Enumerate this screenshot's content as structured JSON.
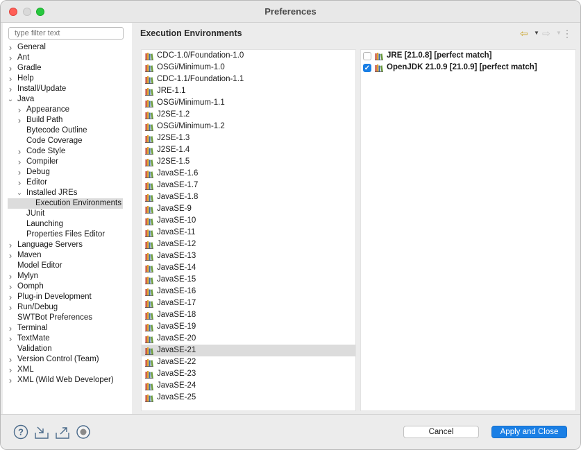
{
  "window": {
    "title": "Preferences"
  },
  "filter": {
    "placeholder": "type filter text"
  },
  "tree": [
    {
      "label": "General",
      "level": 0,
      "expandable": true,
      "expanded": false,
      "name": "tree-item-general"
    },
    {
      "label": "Ant",
      "level": 0,
      "expandable": true,
      "expanded": false,
      "name": "tree-item-ant"
    },
    {
      "label": "Gradle",
      "level": 0,
      "expandable": true,
      "expanded": false,
      "name": "tree-item-gradle"
    },
    {
      "label": "Help",
      "level": 0,
      "expandable": true,
      "expanded": false,
      "name": "tree-item-help"
    },
    {
      "label": "Install/Update",
      "level": 0,
      "expandable": true,
      "expanded": false,
      "name": "tree-item-install-update"
    },
    {
      "label": "Java",
      "level": 0,
      "expandable": true,
      "expanded": true,
      "name": "tree-item-java"
    },
    {
      "label": "Appearance",
      "level": 1,
      "expandable": true,
      "expanded": false,
      "name": "tree-item-appearance"
    },
    {
      "label": "Build Path",
      "level": 1,
      "expandable": true,
      "expanded": false,
      "name": "tree-item-build-path"
    },
    {
      "label": "Bytecode Outline",
      "level": 1,
      "expandable": false,
      "name": "tree-item-bytecode-outline"
    },
    {
      "label": "Code Coverage",
      "level": 1,
      "expandable": false,
      "name": "tree-item-code-coverage"
    },
    {
      "label": "Code Style",
      "level": 1,
      "expandable": true,
      "expanded": false,
      "name": "tree-item-code-style"
    },
    {
      "label": "Compiler",
      "level": 1,
      "expandable": true,
      "expanded": false,
      "name": "tree-item-compiler"
    },
    {
      "label": "Debug",
      "level": 1,
      "expandable": true,
      "expanded": false,
      "name": "tree-item-debug"
    },
    {
      "label": "Editor",
      "level": 1,
      "expandable": true,
      "expanded": false,
      "name": "tree-item-editor"
    },
    {
      "label": "Installed JREs",
      "level": 1,
      "expandable": true,
      "expanded": true,
      "name": "tree-item-installed-jres"
    },
    {
      "label": "Execution Environments",
      "level": 2,
      "expandable": false,
      "selected": true,
      "name": "tree-item-execution-environments"
    },
    {
      "label": "JUnit",
      "level": 1,
      "expandable": false,
      "name": "tree-item-junit"
    },
    {
      "label": "Launching",
      "level": 1,
      "expandable": false,
      "name": "tree-item-launching"
    },
    {
      "label": "Properties Files Editor",
      "level": 1,
      "expandable": false,
      "name": "tree-item-properties-files-editor"
    },
    {
      "label": "Language Servers",
      "level": 0,
      "expandable": true,
      "expanded": false,
      "name": "tree-item-language-servers"
    },
    {
      "label": "Maven",
      "level": 0,
      "expandable": true,
      "expanded": false,
      "name": "tree-item-maven"
    },
    {
      "label": "Model Editor",
      "level": 0,
      "expandable": false,
      "name": "tree-item-model-editor"
    },
    {
      "label": "Mylyn",
      "level": 0,
      "expandable": true,
      "expanded": false,
      "name": "tree-item-mylyn"
    },
    {
      "label": "Oomph",
      "level": 0,
      "expandable": true,
      "expanded": false,
      "name": "tree-item-oomph"
    },
    {
      "label": "Plug-in Development",
      "level": 0,
      "expandable": true,
      "expanded": false,
      "name": "tree-item-plugin-development"
    },
    {
      "label": "Run/Debug",
      "level": 0,
      "expandable": true,
      "expanded": false,
      "name": "tree-item-run-debug"
    },
    {
      "label": "SWTBot Preferences",
      "level": 0,
      "expandable": false,
      "name": "tree-item-swtbot-preferences"
    },
    {
      "label": "Terminal",
      "level": 0,
      "expandable": true,
      "expanded": false,
      "name": "tree-item-terminal"
    },
    {
      "label": "TextMate",
      "level": 0,
      "expandable": true,
      "expanded": false,
      "name": "tree-item-textmate"
    },
    {
      "label": "Validation",
      "level": 0,
      "expandable": false,
      "name": "tree-item-validation"
    },
    {
      "label": "Version Control (Team)",
      "level": 0,
      "expandable": true,
      "expanded": false,
      "name": "tree-item-version-control"
    },
    {
      "label": "XML",
      "level": 0,
      "expandable": true,
      "expanded": false,
      "name": "tree-item-xml"
    },
    {
      "label": "XML (Wild Web Developer)",
      "level": 0,
      "expandable": true,
      "expanded": false,
      "name": "tree-item-xml-wild-web-developer"
    }
  ],
  "content": {
    "title": "Execution Environments"
  },
  "nav": {
    "back_icon": "back-arrow-icon",
    "forward_icon": "forward-arrow-icon",
    "menu_icon": "view-menu-icon"
  },
  "environments": [
    {
      "label": "CDC-1.0/Foundation-1.0"
    },
    {
      "label": "OSGi/Minimum-1.0"
    },
    {
      "label": "CDC-1.1/Foundation-1.1"
    },
    {
      "label": "JRE-1.1"
    },
    {
      "label": "OSGi/Minimum-1.1"
    },
    {
      "label": "J2SE-1.2"
    },
    {
      "label": "OSGi/Minimum-1.2"
    },
    {
      "label": "J2SE-1.3"
    },
    {
      "label": "J2SE-1.4"
    },
    {
      "label": "J2SE-1.5"
    },
    {
      "label": "JavaSE-1.6"
    },
    {
      "label": "JavaSE-1.7"
    },
    {
      "label": "JavaSE-1.8"
    },
    {
      "label": "JavaSE-9"
    },
    {
      "label": "JavaSE-10"
    },
    {
      "label": "JavaSE-11"
    },
    {
      "label": "JavaSE-12"
    },
    {
      "label": "JavaSE-13"
    },
    {
      "label": "JavaSE-14"
    },
    {
      "label": "JavaSE-15"
    },
    {
      "label": "JavaSE-16"
    },
    {
      "label": "JavaSE-17"
    },
    {
      "label": "JavaSE-18"
    },
    {
      "label": "JavaSE-19"
    },
    {
      "label": "JavaSE-20"
    },
    {
      "label": "JavaSE-21",
      "selected": true
    },
    {
      "label": "JavaSE-22"
    },
    {
      "label": "JavaSE-23"
    },
    {
      "label": "JavaSE-24"
    },
    {
      "label": "JavaSE-25"
    }
  ],
  "compatible_jres": [
    {
      "label": "JRE [21.0.8] [perfect match]",
      "checked": false
    },
    {
      "label": "OpenJDK 21.0.9 [21.0.9] [perfect match]",
      "checked": true
    }
  ],
  "bottom": {
    "icons": [
      "help-icon",
      "import-icon",
      "export-icon",
      "record-icon"
    ],
    "cancel_label": "Cancel",
    "apply_label": "Apply and Close"
  },
  "colors": {
    "accent": "#1a7fe5",
    "selection": "#dcdcdc",
    "panel_bg": "#ffffff",
    "window_bg": "#ececec"
  }
}
